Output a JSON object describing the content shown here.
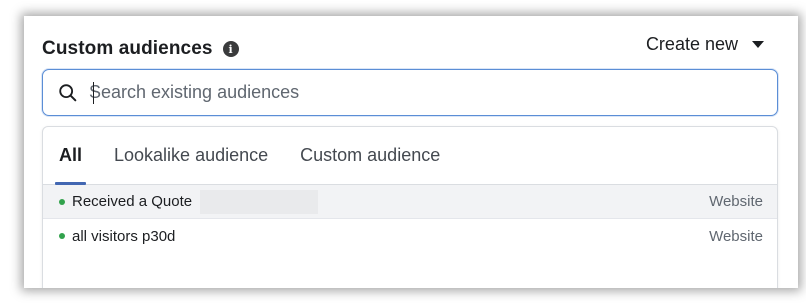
{
  "panel": {
    "title": "Custom audiences",
    "info_icon": "info-icon",
    "create_new_label": "Create new",
    "create_new_icon": "caret-down-icon"
  },
  "search": {
    "icon": "search-icon",
    "placeholder": "Search existing audiences",
    "value": ""
  },
  "tabs": [
    {
      "label": "All",
      "active": true
    },
    {
      "label": "Lookalike audience",
      "active": false
    },
    {
      "label": "Custom audience",
      "active": false
    }
  ],
  "audiences": [
    {
      "name": "Received a Quote",
      "source": "Website",
      "status_color": "#31a24c",
      "highlighted": true
    },
    {
      "name": "all visitors p30d",
      "source": "Website",
      "status_color": "#31a24c",
      "highlighted": false
    }
  ],
  "colors": {
    "accent": "#4267b2",
    "search_border": "#5b8ed6",
    "status_active": "#31a24c"
  }
}
